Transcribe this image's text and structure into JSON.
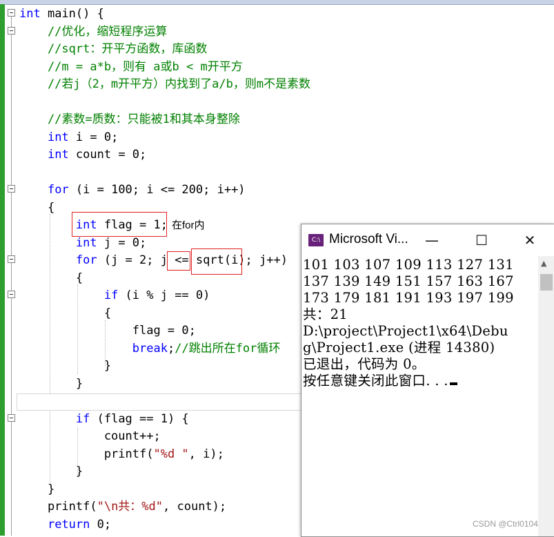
{
  "editor": {
    "lines": [
      [
        {
          "t": "int",
          "c": "kw"
        },
        {
          "t": " main() {",
          "c": ""
        }
      ],
      [
        {
          "t": "    //优化，缩短程序运算",
          "c": "cm"
        }
      ],
      [
        {
          "t": "    //sqrt：开平方函数，库函数",
          "c": "cm"
        }
      ],
      [
        {
          "t": "    //m = a*b，则有 a或b < m开平方",
          "c": "cm"
        }
      ],
      [
        {
          "t": "    //若j（2，m开平方）内找到了a/b，则m不是素数",
          "c": "cm"
        }
      ],
      [
        {
          "t": "",
          "c": ""
        }
      ],
      [
        {
          "t": "    //素数=质数：只能被1和其本身整除",
          "c": "cm"
        }
      ],
      [
        {
          "t": "    ",
          "c": ""
        },
        {
          "t": "int",
          "c": "kw"
        },
        {
          "t": " i = 0;",
          "c": ""
        }
      ],
      [
        {
          "t": "    ",
          "c": ""
        },
        {
          "t": "int",
          "c": "kw"
        },
        {
          "t": " count = 0;",
          "c": ""
        }
      ],
      [
        {
          "t": "",
          "c": ""
        }
      ],
      [
        {
          "t": "    ",
          "c": ""
        },
        {
          "t": "for",
          "c": "kw"
        },
        {
          "t": " (i = 100; i <= 200; i++)",
          "c": ""
        }
      ],
      [
        {
          "t": "    {",
          "c": ""
        }
      ],
      [
        {
          "t": "        ",
          "c": ""
        },
        {
          "t": "int",
          "c": "kw"
        },
        {
          "t": " flag = 1;",
          "c": ""
        }
      ],
      [
        {
          "t": "        ",
          "c": ""
        },
        {
          "t": "int",
          "c": "kw"
        },
        {
          "t": " j = 0;",
          "c": ""
        }
      ],
      [
        {
          "t": "        ",
          "c": ""
        },
        {
          "t": "for",
          "c": "kw"
        },
        {
          "t": " (j = 2; j <= sqrt(i); j++)",
          "c": ""
        }
      ],
      [
        {
          "t": "        {",
          "c": ""
        }
      ],
      [
        {
          "t": "            ",
          "c": ""
        },
        {
          "t": "if",
          "c": "kw"
        },
        {
          "t": " (i % j == 0)",
          "c": ""
        }
      ],
      [
        {
          "t": "            {",
          "c": ""
        }
      ],
      [
        {
          "t": "                flag = 0;",
          "c": ""
        }
      ],
      [
        {
          "t": "                ",
          "c": ""
        },
        {
          "t": "break",
          "c": "kw"
        },
        {
          "t": ";",
          "c": ""
        },
        {
          "t": "//跳出所在for循环",
          "c": "cm"
        }
      ],
      [
        {
          "t": "            }",
          "c": ""
        }
      ],
      [
        {
          "t": "        }",
          "c": ""
        }
      ],
      [
        {
          "t": "",
          "c": ""
        }
      ],
      [
        {
          "t": "        ",
          "c": ""
        },
        {
          "t": "if",
          "c": "kw"
        },
        {
          "t": " (flag == 1) {",
          "c": ""
        }
      ],
      [
        {
          "t": "            count++;",
          "c": ""
        }
      ],
      [
        {
          "t": "            printf(",
          "c": ""
        },
        {
          "t": "\"%d \"",
          "c": "st"
        },
        {
          "t": ", i);",
          "c": ""
        }
      ],
      [
        {
          "t": "        }",
          "c": ""
        }
      ],
      [
        {
          "t": "    }",
          "c": ""
        }
      ],
      [
        {
          "t": "    printf(",
          "c": ""
        },
        {
          "t": "\"\\n共：%d\"",
          "c": "st"
        },
        {
          "t": ", count);",
          "c": ""
        }
      ],
      [
        {
          "t": "    ",
          "c": ""
        },
        {
          "t": "return",
          "c": "kw"
        },
        {
          "t": " 0;",
          "c": ""
        }
      ]
    ],
    "annotation": "在for内"
  },
  "console": {
    "title": "Microsoft Vi...",
    "icon_label": "C:\\",
    "minimize_glyph": "—",
    "maximize_glyph": "☐",
    "close_glyph": "✕",
    "output_lines": [
      "101 103 107 109 113 127 131",
      "137 139 149 151 157 163 167",
      "173 179 181 191 193 197 199",
      "共：21",
      "D:\\project\\Project1\\x64\\Debu",
      "g\\Project1.exe (进程 14380)",
      "已退出，代码为 0。",
      "按任意键关闭此窗口. . ."
    ]
  },
  "watermark": "CSDN @Ctrl0104"
}
